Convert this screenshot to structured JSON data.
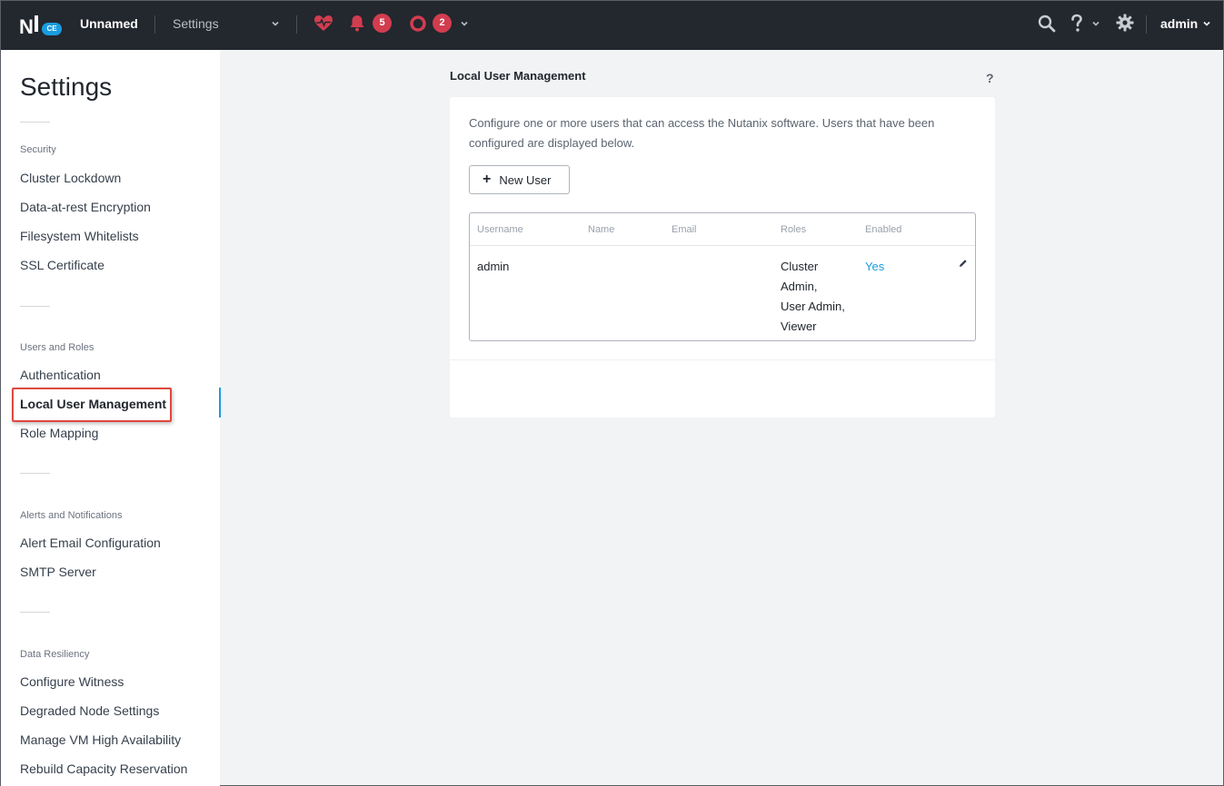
{
  "topbar": {
    "logo_text": "N",
    "logo_badge": "CE",
    "cluster_name": "Unnamed",
    "current_view": "Settings",
    "alerts_count": "5",
    "events_count": "2",
    "user_label": "admin",
    "help_symbol": "?",
    "icons": [
      "health-heart-icon",
      "bell-icon",
      "record-circle-icon",
      "search-icon",
      "help-icon",
      "gear-icon"
    ],
    "accent_color": "#1a9ce0",
    "badge_color": "#d13d4f"
  },
  "sidebar": {
    "title": "Settings",
    "groups": [
      {
        "label": "Security",
        "items": [
          "Cluster Lockdown",
          "Data-at-rest Encryption",
          "Filesystem Whitelists",
          "SSL Certificate"
        ]
      },
      {
        "label": "Users and Roles",
        "items": [
          "Authentication",
          "Local User Management",
          "Role Mapping"
        ]
      },
      {
        "label": "Alerts and Notifications",
        "items": [
          "Alert Email Configuration",
          "SMTP Server"
        ]
      },
      {
        "label": "Data Resiliency",
        "items": [
          "Configure Witness",
          "Degraded Node Settings",
          "Manage VM High Availability",
          "Rebuild Capacity Reservation"
        ]
      }
    ],
    "active_item": "Local User Management"
  },
  "main": {
    "title": "Local User Management",
    "help_symbol": "?",
    "description": "Configure one or more users that can access the Nutanix software. Users that have been configured are displayed below.",
    "new_user_label": "New User",
    "table": {
      "columns": [
        "Username",
        "Name",
        "Email",
        "Roles",
        "Enabled"
      ],
      "rows": [
        {
          "username": "admin",
          "name": "",
          "email": "",
          "roles": "Cluster Admin, User Admin, Viewer",
          "roles_lines": [
            "Cluster",
            "Admin,",
            "User Admin,",
            "Viewer"
          ],
          "enabled": "Yes"
        }
      ]
    }
  }
}
